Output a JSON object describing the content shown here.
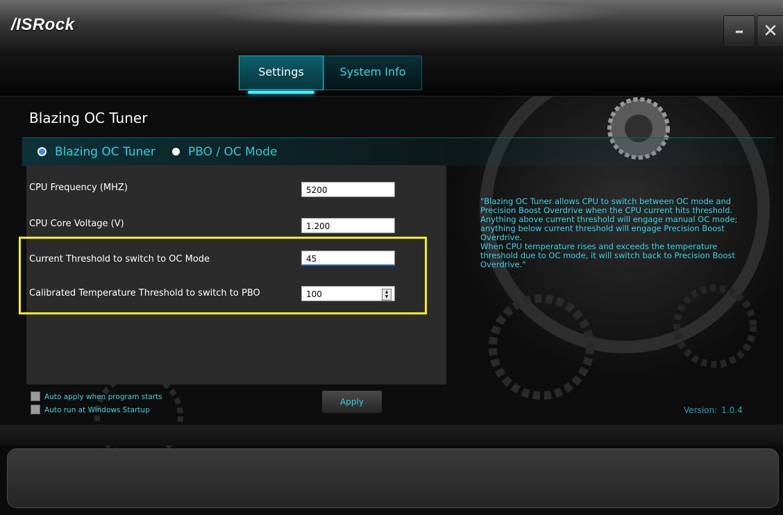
{
  "window": {
    "logo_text": "/ISRock",
    "minimize_icon": "minimize-icon",
    "close_icon": "close-icon"
  },
  "tabs": [
    {
      "label": "Settings",
      "active": true
    },
    {
      "label": "System Info",
      "active": false
    }
  ],
  "section_title": "Blazing OC Tuner",
  "modes": [
    {
      "label": "Blazing OC Tuner",
      "selected": true
    },
    {
      "label": "PBO / OC Mode",
      "selected": false
    }
  ],
  "settings": [
    {
      "label": "CPU Frequency (MHZ)",
      "value": "5200"
    },
    {
      "label": "CPU Core Voltage (V)",
      "value": "1.200"
    },
    {
      "label": "Current Threshold to switch to OC Mode",
      "value": "45"
    },
    {
      "label": "Calibrated Temperature  Threshold to switch to PBO",
      "value": "100"
    }
  ],
  "description": "\"Blazing OC Tuner allows CPU to switch between OC mode and\nPrecision Boost Overdrive when the CPU current hits threshold.\nAnything above current threshold will engage manual OC mode;\nanything below current threshold will engage Precision Boost\nOverdrive.\nWhen CPU temperature rises and exceeds the temperature\nthreshold due to OC mode, it will switch back to Precision Boost\nOverdrive.\"",
  "checkboxes": [
    {
      "label": "Auto apply when program starts",
      "checked": false
    },
    {
      "label": "Auto run at Windows Startup",
      "checked": false
    }
  ],
  "apply_label": "Apply",
  "version": {
    "label": "Version:",
    "value": "1.0.4"
  },
  "colors": {
    "accent": "#33d6e6",
    "highlight": "#f5f000",
    "panel": "#2b2b2b"
  }
}
